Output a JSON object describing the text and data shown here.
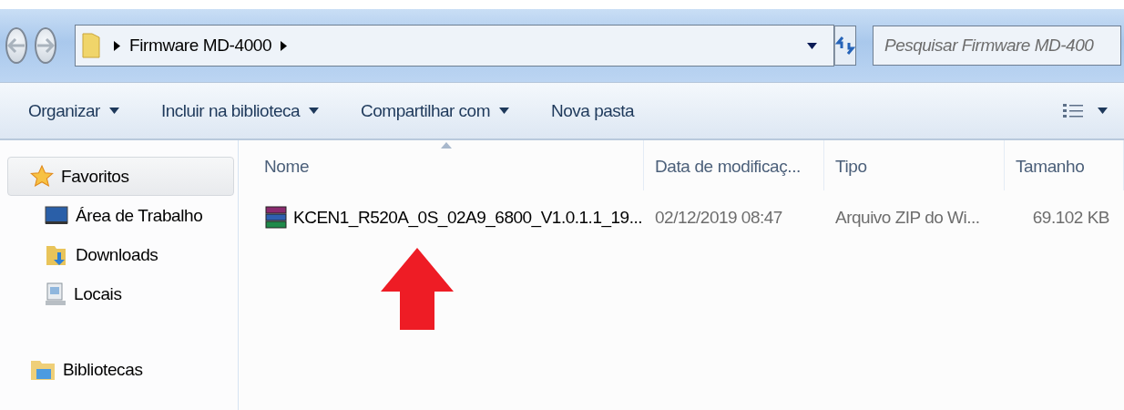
{
  "address_bar": {
    "path": [
      "Firmware MD-4000"
    ],
    "search_placeholder": "Pesquisar Firmware MD-400"
  },
  "toolbar": [
    {
      "label": "Organizar",
      "dropdown": true
    },
    {
      "label": "Incluir na biblioteca",
      "dropdown": true
    },
    {
      "label": "Compartilhar com",
      "dropdown": true
    },
    {
      "label": "Nova pasta",
      "dropdown": false
    }
  ],
  "sidebar": [
    {
      "label": "Favoritos",
      "kind": "star",
      "selected": true,
      "children": [
        {
          "label": "Área de Trabalho",
          "kind": "desktop",
          "selected": false
        },
        {
          "label": "Downloads",
          "kind": "downloads",
          "selected": false
        },
        {
          "label": "Locais",
          "kind": "places",
          "selected": false
        }
      ]
    },
    {
      "label": "Bibliotecas",
      "kind": "library",
      "selected": false
    }
  ],
  "table": {
    "columns": [
      {
        "label": "Nome",
        "sorted": true
      },
      {
        "label": "Data de modificaç...",
        "sorted": false
      },
      {
        "label": "Tipo",
        "sorted": false
      },
      {
        "label": "Tamanho",
        "sorted": false
      }
    ],
    "rows": [
      {
        "name": "KCEN1_R520A_0S_02A9_6800_V1.0.1.1_19...",
        "date": "02/12/2019 08:47",
        "type": "Arquivo ZIP do Wi...",
        "size": "69.102 KB"
      }
    ]
  }
}
